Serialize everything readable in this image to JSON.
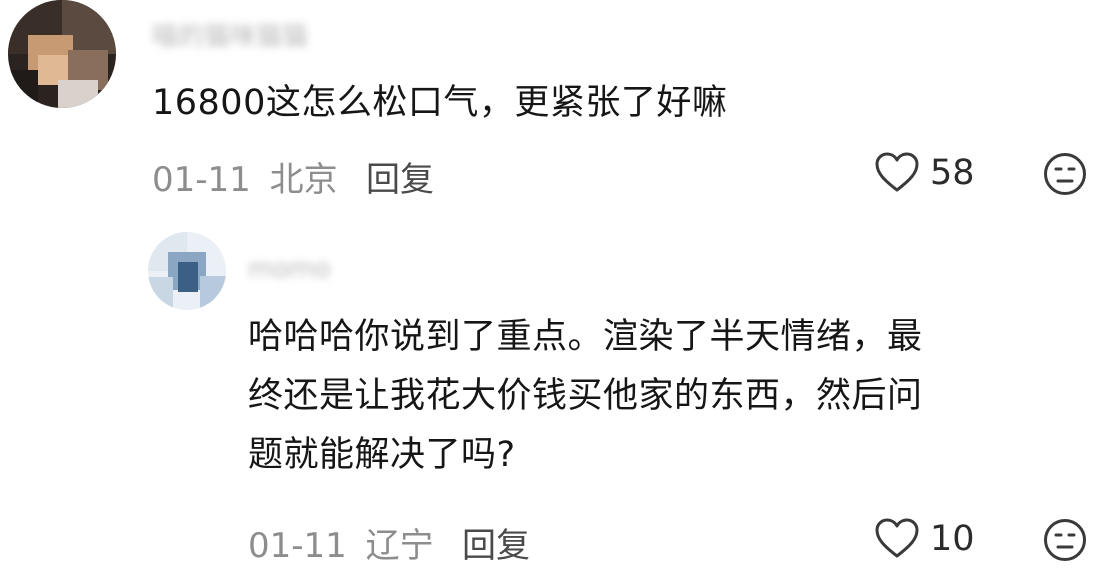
{
  "comments": [
    {
      "username": "喵的猫咪猫猫",
      "text": "16800这怎么松口气，更紧张了好嘛",
      "date": "01-11",
      "location": "北京",
      "reply_label": "回复",
      "likes": "58",
      "reaction_icon": "neutral-face-icon",
      "like_icon": "heart-outline-icon"
    },
    {
      "username": "momo",
      "text_lines": [
        "哈哈哈你说到了重点。渲染了半天情绪，最",
        "终还是让我花大价钱买他家的东西，然后问",
        "题就能解决了吗?"
      ],
      "date": "01-11",
      "location": "辽宁",
      "reply_label": "回复",
      "likes": "10",
      "reaction_icon": "neutral-face-icon",
      "like_icon": "heart-outline-icon"
    }
  ],
  "colors": {
    "text": "#161616",
    "meta": "#8d8d8d",
    "reply": "#4a4a4a",
    "icon": "#3a3a3a"
  }
}
